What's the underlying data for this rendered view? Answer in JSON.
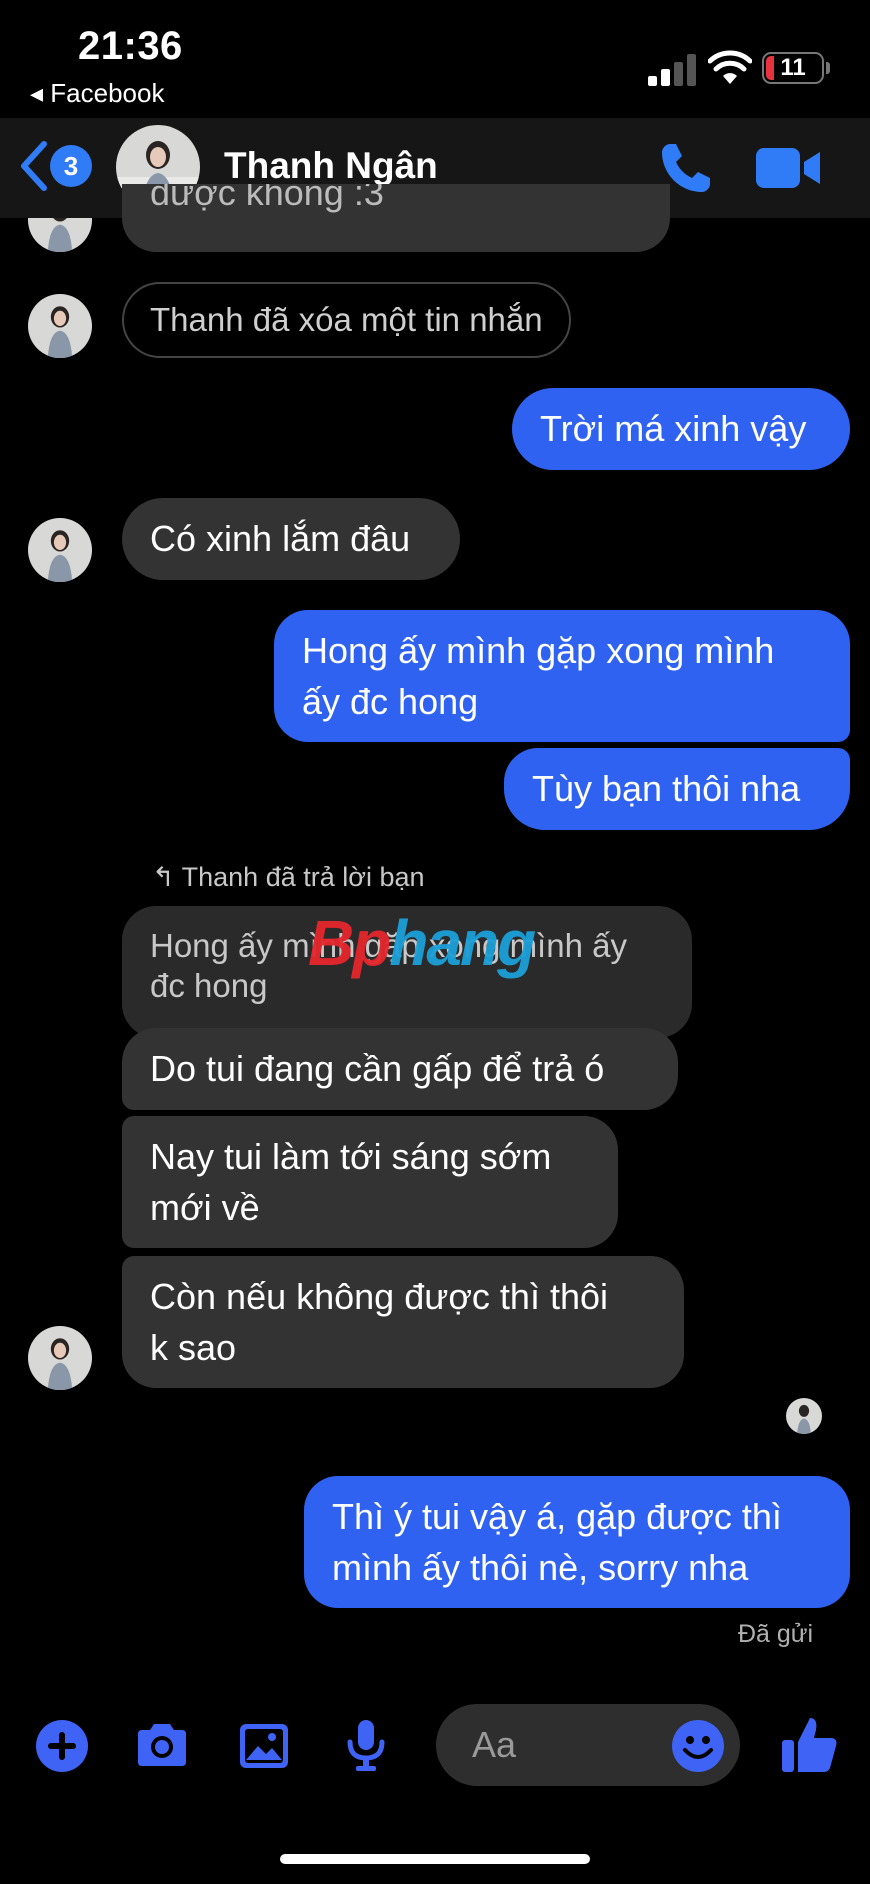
{
  "status_bar": {
    "time": "21:36",
    "back_app": "◂ Facebook",
    "battery": "11",
    "battery_color": "#e8323f"
  },
  "header": {
    "unread_count": "3",
    "contact_name": "Thanh Ngân",
    "icons": [
      "back-chevron-icon",
      "phone-icon",
      "video-camera-icon"
    ],
    "accent_color": "#2f7cf6"
  },
  "messages": [
    {
      "from": "them",
      "text": "được không :3"
    },
    {
      "from": "them",
      "type": "deleted",
      "text": "Thanh đã xóa một tin nhắn"
    },
    {
      "from": "me",
      "text": "Trời má xinh vậy"
    },
    {
      "from": "them",
      "text": "Có xinh lắm đâu"
    },
    {
      "from": "me",
      "lines": [
        "Hong ấy mình gặp xong mình",
        "ấy đc hong"
      ]
    },
    {
      "from": "me",
      "text": "Tùy bạn thôi nha"
    },
    {
      "from": "them",
      "type": "reply_note",
      "text": "Thanh đã trả lời bạn"
    },
    {
      "from": "them",
      "type": "quoted",
      "lines": [
        "Hong ấy mình gặp xong mình ấy",
        "đc hong"
      ]
    },
    {
      "from": "them",
      "text": "Do tui đang cần gấp để trả ó"
    },
    {
      "from": "them",
      "lines": [
        "Nay tui làm tới sáng sớm",
        "mới về"
      ]
    },
    {
      "from": "them",
      "lines": [
        "Còn nếu không được thì thôi",
        "k sao"
      ]
    },
    {
      "from": "me",
      "lines": [
        "Thì ý tui vậy á, gặp được thì",
        "mình ấy thôi nè, sorry nha"
      ]
    }
  ],
  "delivery_status": "Đã gửi",
  "watermark": {
    "part1": "Bp",
    "part2": "hang",
    "color1": "#e5262d",
    "color2": "#1c9fd8"
  },
  "composer": {
    "placeholder": "Aa",
    "icons": [
      "plus-icon",
      "camera-icon",
      "gallery-icon",
      "microphone-icon",
      "emoji-icon",
      "thumbs-up-icon"
    ]
  },
  "colors": {
    "outgoing_bubble": "#2f62f0",
    "incoming_bubble": "#333333",
    "background": "#000000"
  }
}
